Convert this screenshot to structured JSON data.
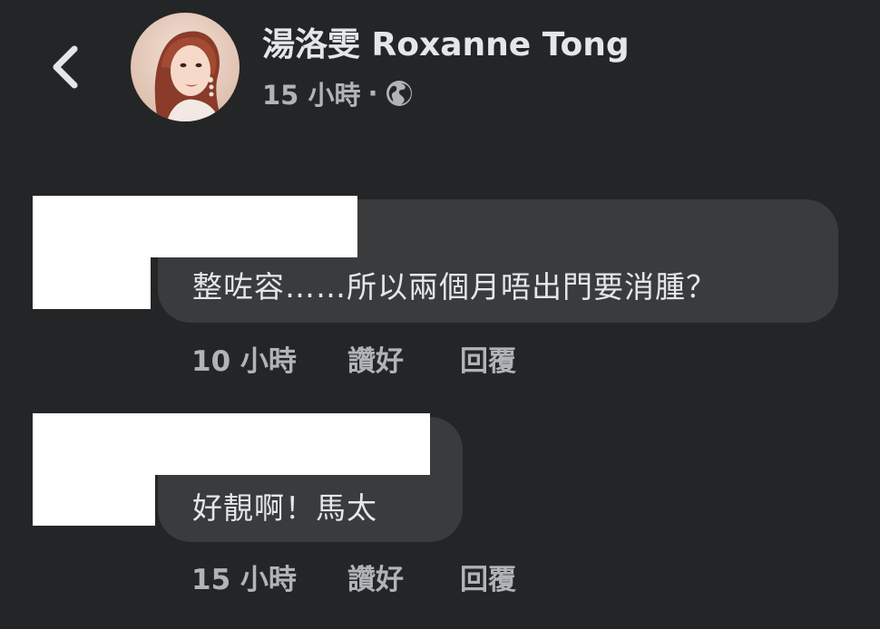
{
  "header": {
    "back_icon": "chevron-left-icon",
    "author_name": "湯洛雯 Roxanne Tong",
    "timestamp": "15 小時",
    "separator": "·",
    "privacy_icon": "globe-icon"
  },
  "comments": [
    {
      "text": "整咗容……所以兩個月唔出門要消腫？",
      "time": "10 小時",
      "like_label": "讚好",
      "reply_label": "回覆"
    },
    {
      "text": "好靚啊！馬太",
      "time": "15 小時",
      "like_label": "讚好",
      "reply_label": "回覆"
    }
  ],
  "colors": {
    "background": "#242526",
    "bubble": "#3a3b3c",
    "primary_text": "#e4e6eb",
    "secondary_text": "#b0b3b8",
    "redaction": "#ffffff"
  }
}
